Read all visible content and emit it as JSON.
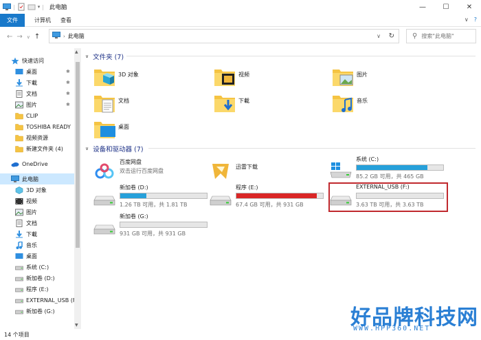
{
  "window": {
    "title": "此电脑",
    "controls": [
      "—",
      "☐",
      "✕"
    ]
  },
  "ribbon": {
    "tabs": [
      "文件",
      "计算机",
      "查看"
    ],
    "expand_icon": "∨",
    "help_icon": "?"
  },
  "address": {
    "crumb": "此电脑",
    "search_placeholder": "搜索\"此电脑\"",
    "refresh": "↻",
    "dropdown": "∨"
  },
  "nav": {
    "back": "←",
    "forward": "→",
    "history": "∨",
    "up": "↑"
  },
  "sidebar": {
    "items": [
      {
        "label": "快速访问",
        "icon": "star-icon",
        "indent": 1,
        "pin": false
      },
      {
        "label": "桌面",
        "icon": "desktop-icon",
        "indent": 2,
        "pin": true
      },
      {
        "label": "下載",
        "icon": "download-icon",
        "indent": 2,
        "pin": true
      },
      {
        "label": "文档",
        "icon": "document-icon",
        "indent": 2,
        "pin": true
      },
      {
        "label": "图片",
        "icon": "picture-icon",
        "indent": 2,
        "pin": true
      },
      {
        "label": "CLIP",
        "icon": "folder-icon",
        "indent": 2,
        "pin": false
      },
      {
        "label": "TOSHIBA READY",
        "icon": "folder-icon",
        "indent": 2,
        "pin": false
      },
      {
        "label": "视频资源",
        "icon": "folder-icon",
        "indent": 2,
        "pin": false
      },
      {
        "label": "新建文件夹 (4)",
        "icon": "folder-icon",
        "indent": 2,
        "pin": false
      },
      {
        "label": "OneDrive",
        "icon": "cloud-icon",
        "indent": 1,
        "pin": false
      },
      {
        "label": "此电脑",
        "icon": "computer-icon",
        "indent": 1,
        "pin": false,
        "selected": true
      },
      {
        "label": "3D 对象",
        "icon": "3d-icon",
        "indent": 2,
        "pin": false
      },
      {
        "label": "视频",
        "icon": "video-icon",
        "indent": 2,
        "pin": false
      },
      {
        "label": "图片",
        "icon": "picture-icon",
        "indent": 2,
        "pin": false
      },
      {
        "label": "文档",
        "icon": "document-icon",
        "indent": 2,
        "pin": false
      },
      {
        "label": "下載",
        "icon": "download-icon",
        "indent": 2,
        "pin": false
      },
      {
        "label": "音乐",
        "icon": "music-icon",
        "indent": 2,
        "pin": false
      },
      {
        "label": "桌面",
        "icon": "desktop-icon",
        "indent": 2,
        "pin": false
      },
      {
        "label": "系统 (C:)",
        "icon": "drive-icon",
        "indent": 2,
        "pin": false
      },
      {
        "label": "新加卷 (D:)",
        "icon": "drive-icon",
        "indent": 2,
        "pin": false
      },
      {
        "label": "程序 (E:)",
        "icon": "drive-icon",
        "indent": 2,
        "pin": false
      },
      {
        "label": "EXTERNAL_USB (F",
        "icon": "drive-icon",
        "indent": 2,
        "pin": false
      },
      {
        "label": "新加卷 (G:)",
        "icon": "drive-icon",
        "indent": 2,
        "pin": false
      }
    ]
  },
  "status": {
    "count": "14 个项目"
  },
  "folders_section": {
    "title": "文件夹 (7)",
    "items": [
      {
        "label": "3D 对象",
        "icon": "3d-objects-folder-icon"
      },
      {
        "label": "视频",
        "icon": "video-folder-icon"
      },
      {
        "label": "图片",
        "icon": "pictures-folder-icon"
      },
      {
        "label": "文档",
        "icon": "documents-folder-icon"
      },
      {
        "label": "下載",
        "icon": "downloads-folder-icon"
      },
      {
        "label": "音乐",
        "icon": "music-folder-icon"
      },
      {
        "label": "桌面",
        "icon": "desktop-folder-icon"
      }
    ]
  },
  "drives_section": {
    "title": "设备和驱动器 (7)",
    "apps": [
      {
        "name": "百度网盘",
        "sub": "双击运行百度网盘",
        "icon": "baidu-netdisk-icon"
      },
      {
        "name": "迅雷下载",
        "sub": "",
        "icon": "xunlei-icon"
      }
    ],
    "drives": [
      {
        "name": "系统 (C:)",
        "space": "85.2 GB 可用，共 465 GB",
        "used_fraction": 0.82,
        "color": "#26a0da",
        "icon": "windows-drive-icon"
      },
      {
        "name": "新加卷 (D:)",
        "space": "1.26 TB 可用，共 1.81 TB",
        "used_fraction": 0.3,
        "color": "#26a0da",
        "icon": "drive-icon"
      },
      {
        "name": "程序 (E:)",
        "space": "67.4 GB 可用，共 931 GB",
        "used_fraction": 0.93,
        "color": "#da2626",
        "icon": "drive-icon"
      },
      {
        "name": "EXTERNAL_USB (F:)",
        "space": "3.63 TB 可用，共 3.63 TB",
        "used_fraction": 0.0,
        "color": "#26a0da",
        "icon": "drive-icon"
      },
      {
        "name": "新加卷 (G:)",
        "space": "931 GB 可用，共 931 GB",
        "used_fraction": 0.0,
        "color": "#26a0da",
        "icon": "drive-icon"
      }
    ]
  },
  "watermark": {
    "brand": "好品牌科技网",
    "url": "WWW.HPP360.NET"
  },
  "colors": {
    "accent": "#1979ca",
    "selection": "#cce8ff",
    "highlight_box": "#c0282d"
  }
}
